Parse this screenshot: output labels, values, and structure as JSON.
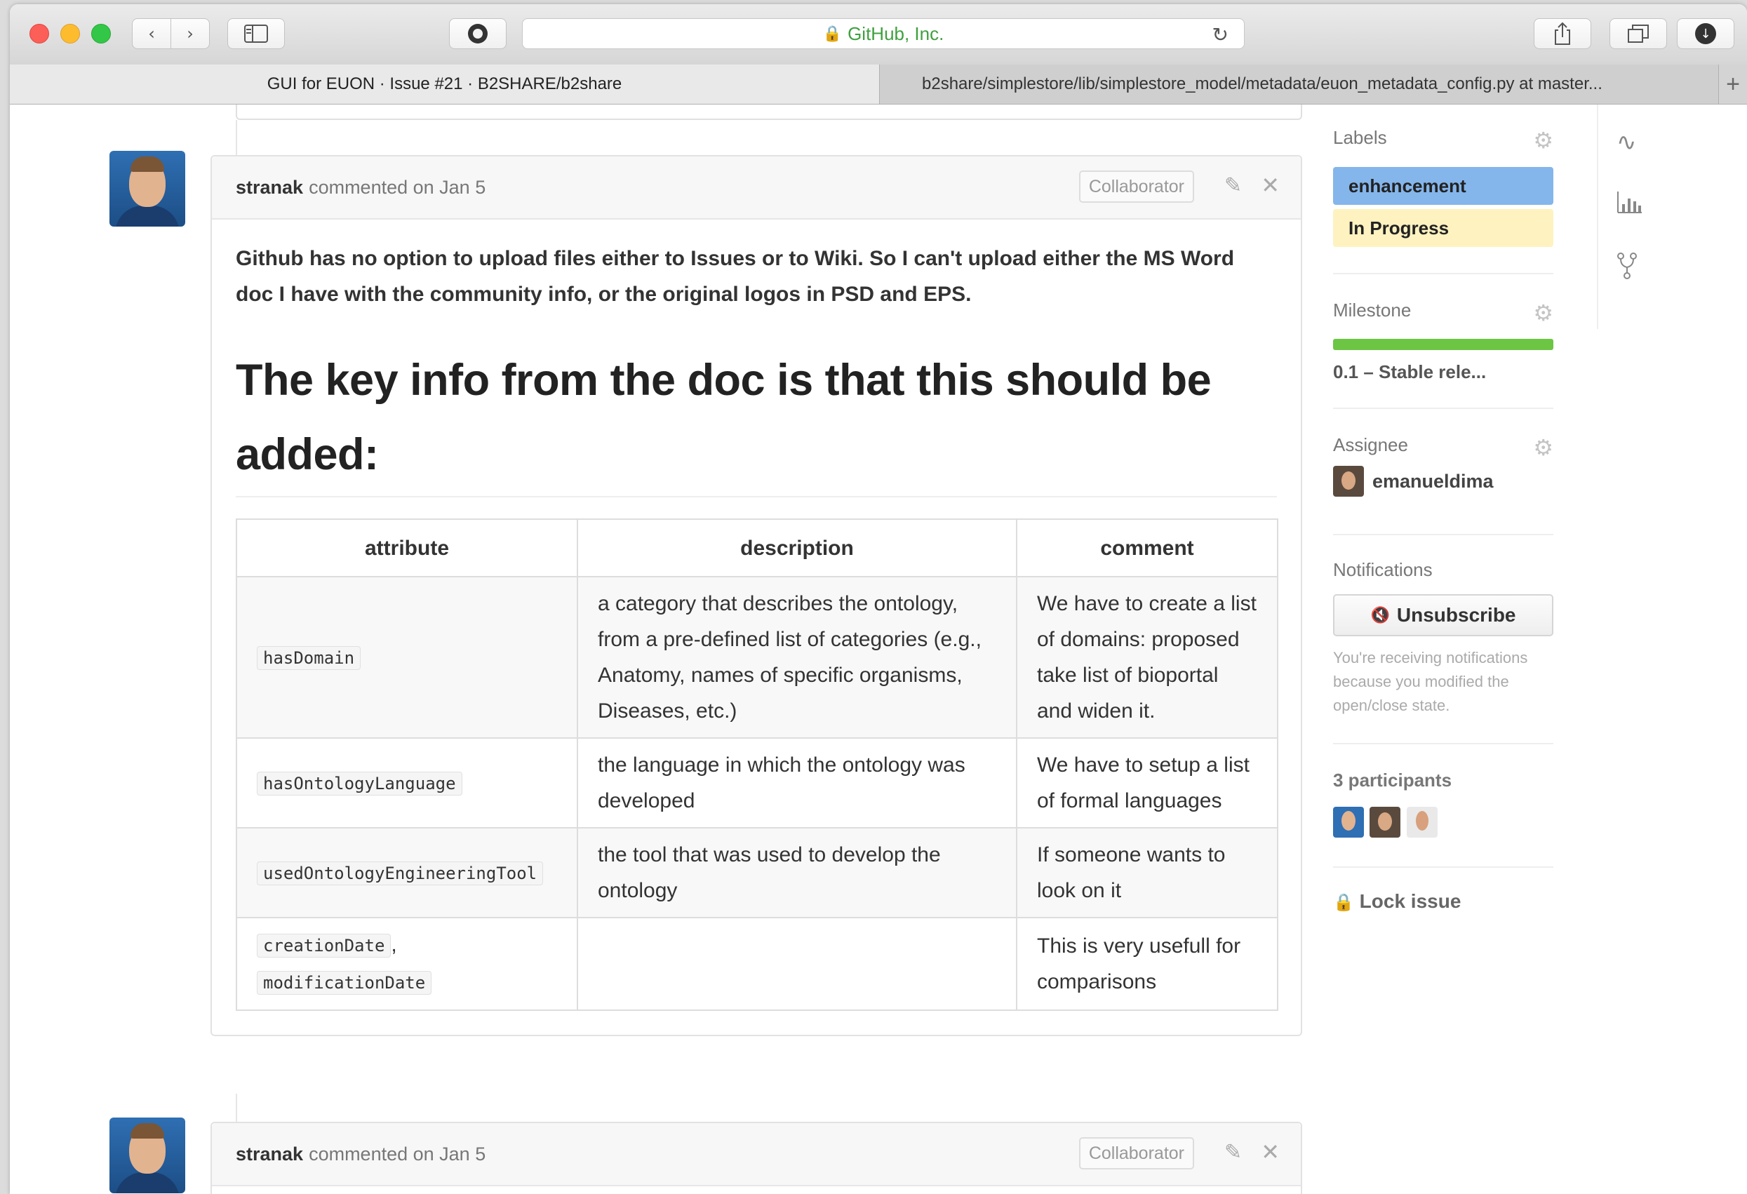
{
  "browser": {
    "address_text": "GitHub, Inc.",
    "lock_glyph": "🔒",
    "reload_glyph": "↻",
    "tabs": [
      {
        "label": "GUI for EUON · Issue #21 · B2SHARE/b2share"
      },
      {
        "label": "b2share/simplestore/lib/simplestore_model/metadata/euon_metadata_config.py at master..."
      }
    ],
    "new_tab_glyph": "+"
  },
  "comments": [
    {
      "author": "stranak",
      "meta": "commented on Jan 5",
      "role": "Collaborator",
      "intro": "Github has no option to upload files either to Issues or to Wiki. So I can't upload either the MS Word doc I have with the community info, or the original logos in PSD and EPS.",
      "headline": "The key info from the doc is that this should be added:",
      "table": {
        "headers": [
          "attribute",
          "description",
          "comment"
        ],
        "rows": [
          {
            "attrs": [
              "hasDomain"
            ],
            "description": "a category that describes the ontology, from a pre-defined list of categories (e.g., Anatomy, names of specific organisms, Diseases, etc.)",
            "comment": "We have to create a list of domains: proposed take list of bioportal and widen it."
          },
          {
            "attrs": [
              "hasOntologyLanguage"
            ],
            "description": "the language in which the ontology was developed",
            "comment": "We have to setup a list of formal languages"
          },
          {
            "attrs": [
              "usedOntologyEngineeringTool"
            ],
            "description": "the tool that was used to develop the ontology",
            "comment": "If someone wants to look on it"
          },
          {
            "attrs": [
              "creationDate",
              "modificationDate"
            ],
            "attr_separator": ",",
            "description": "",
            "comment": "This is very usefull for comparisons"
          }
        ]
      }
    },
    {
      "author": "stranak",
      "meta": "commented on Jan 5",
      "role": "Collaborator"
    }
  ],
  "sidebar": {
    "labels": {
      "heading": "Labels",
      "items": [
        {
          "name": "enhancement",
          "color": "#84b6eb"
        },
        {
          "name": "In Progress",
          "color": "#fef2c0"
        }
      ]
    },
    "milestone": {
      "heading": "Milestone",
      "title": "0.1 – Stable rele...",
      "progress": 1.0,
      "bar_color": "#6cc644"
    },
    "assignee": {
      "heading": "Assignee",
      "name": "emanueldima"
    },
    "notifications": {
      "heading": "Notifications",
      "button_label": "Unsubscribe",
      "button_icon": "🔇",
      "note": "You're receiving notifications because you modified the open/close state."
    },
    "participants": {
      "heading": "3 participants"
    },
    "lock": {
      "label": "Lock issue",
      "icon": "🔒"
    }
  },
  "icons": {
    "gear": "⚙",
    "edit": "✎",
    "close": "✕",
    "pulse": "∿",
    "graph": "📊",
    "fork": "Y"
  }
}
